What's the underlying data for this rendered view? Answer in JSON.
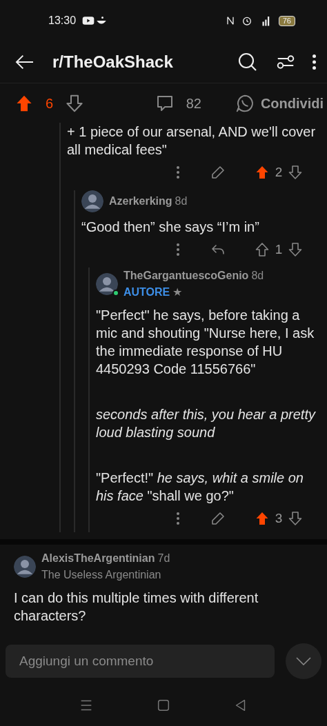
{
  "status_bar": {
    "time": "13:30",
    "battery": "76"
  },
  "header": {
    "title": "r/TheOakShack"
  },
  "post_bar": {
    "upvoted": true,
    "score": "6",
    "comments": "82",
    "share": "Condividi"
  },
  "thread": {
    "body": [
      {
        "text": "+ 1 piece of our arsenal, AND we'll cover all medical fees\""
      }
    ],
    "editable": true,
    "upvoted": true,
    "score": "2",
    "children": [
      {
        "author": "Azerkerking",
        "age": "8d",
        "body": [
          {
            "text": "“Good then” she says “I’m in”"
          }
        ],
        "editable": false,
        "upvoted": false,
        "score": "1",
        "children": [
          {
            "author": "TheGargantuescoGenio",
            "age": "8d",
            "badge": "AUTORE",
            "badge_star": "★",
            "online": true,
            "body": [
              {
                "text": "\"Perfect\" he says, before taking a mic and shouting \"Nurse here, I ask the immediate response of HU 4450293 Code 11556766\"",
                "italic": false
              },
              {
                "text": "seconds after this, you hear a pretty loud blasting sound",
                "italic": true
              },
              {
                "text": "\"Perfect!\" *he says, whit a smile on his face* \"shall we go?\"",
                "italic": false
              }
            ],
            "editable": true,
            "upvoted": true,
            "score": "3"
          }
        ]
      }
    ]
  },
  "next_comment": {
    "author": "AlexisTheArgentinian",
    "age": "7d",
    "flair": "The Useless Argentinian",
    "body": [
      {
        "text": "I can do this multiple times with different characters?"
      }
    ]
  },
  "composer": {
    "placeholder": "Aggiungi un commento"
  }
}
